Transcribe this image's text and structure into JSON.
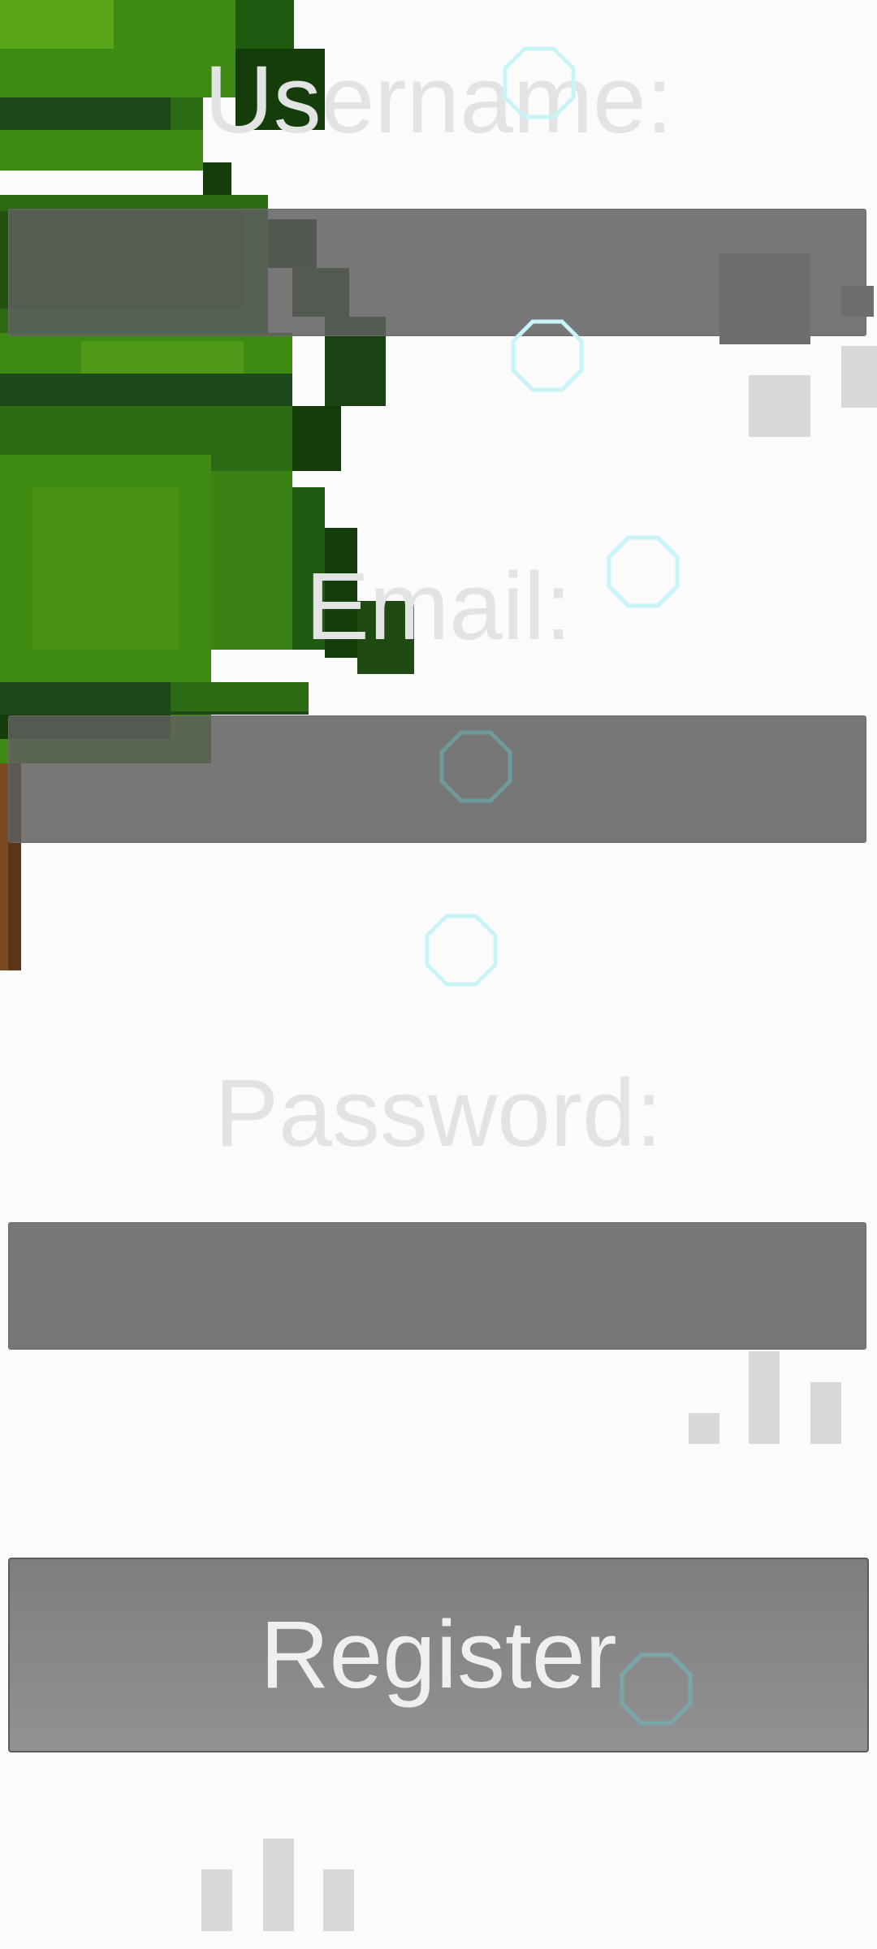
{
  "form": {
    "username_label": "Username:",
    "email_label": "Email:",
    "password_label": "Password:",
    "username_value": "",
    "email_value": "",
    "password_value": "",
    "register_label": "Register"
  },
  "colors": {
    "background": "#fbfbfb",
    "label_text": "#e3e3e3",
    "input_fill": "#767676",
    "button_fill": "#8a8a8a",
    "tree_leaf": "#3f8a12",
    "tree_leaf_dark": "#153d0c",
    "tree_trunk": "#5a3518",
    "bubble_outline": "#c8f4f8"
  },
  "icons": [
    "pixel-tree",
    "bubble",
    "signal-bars"
  ]
}
